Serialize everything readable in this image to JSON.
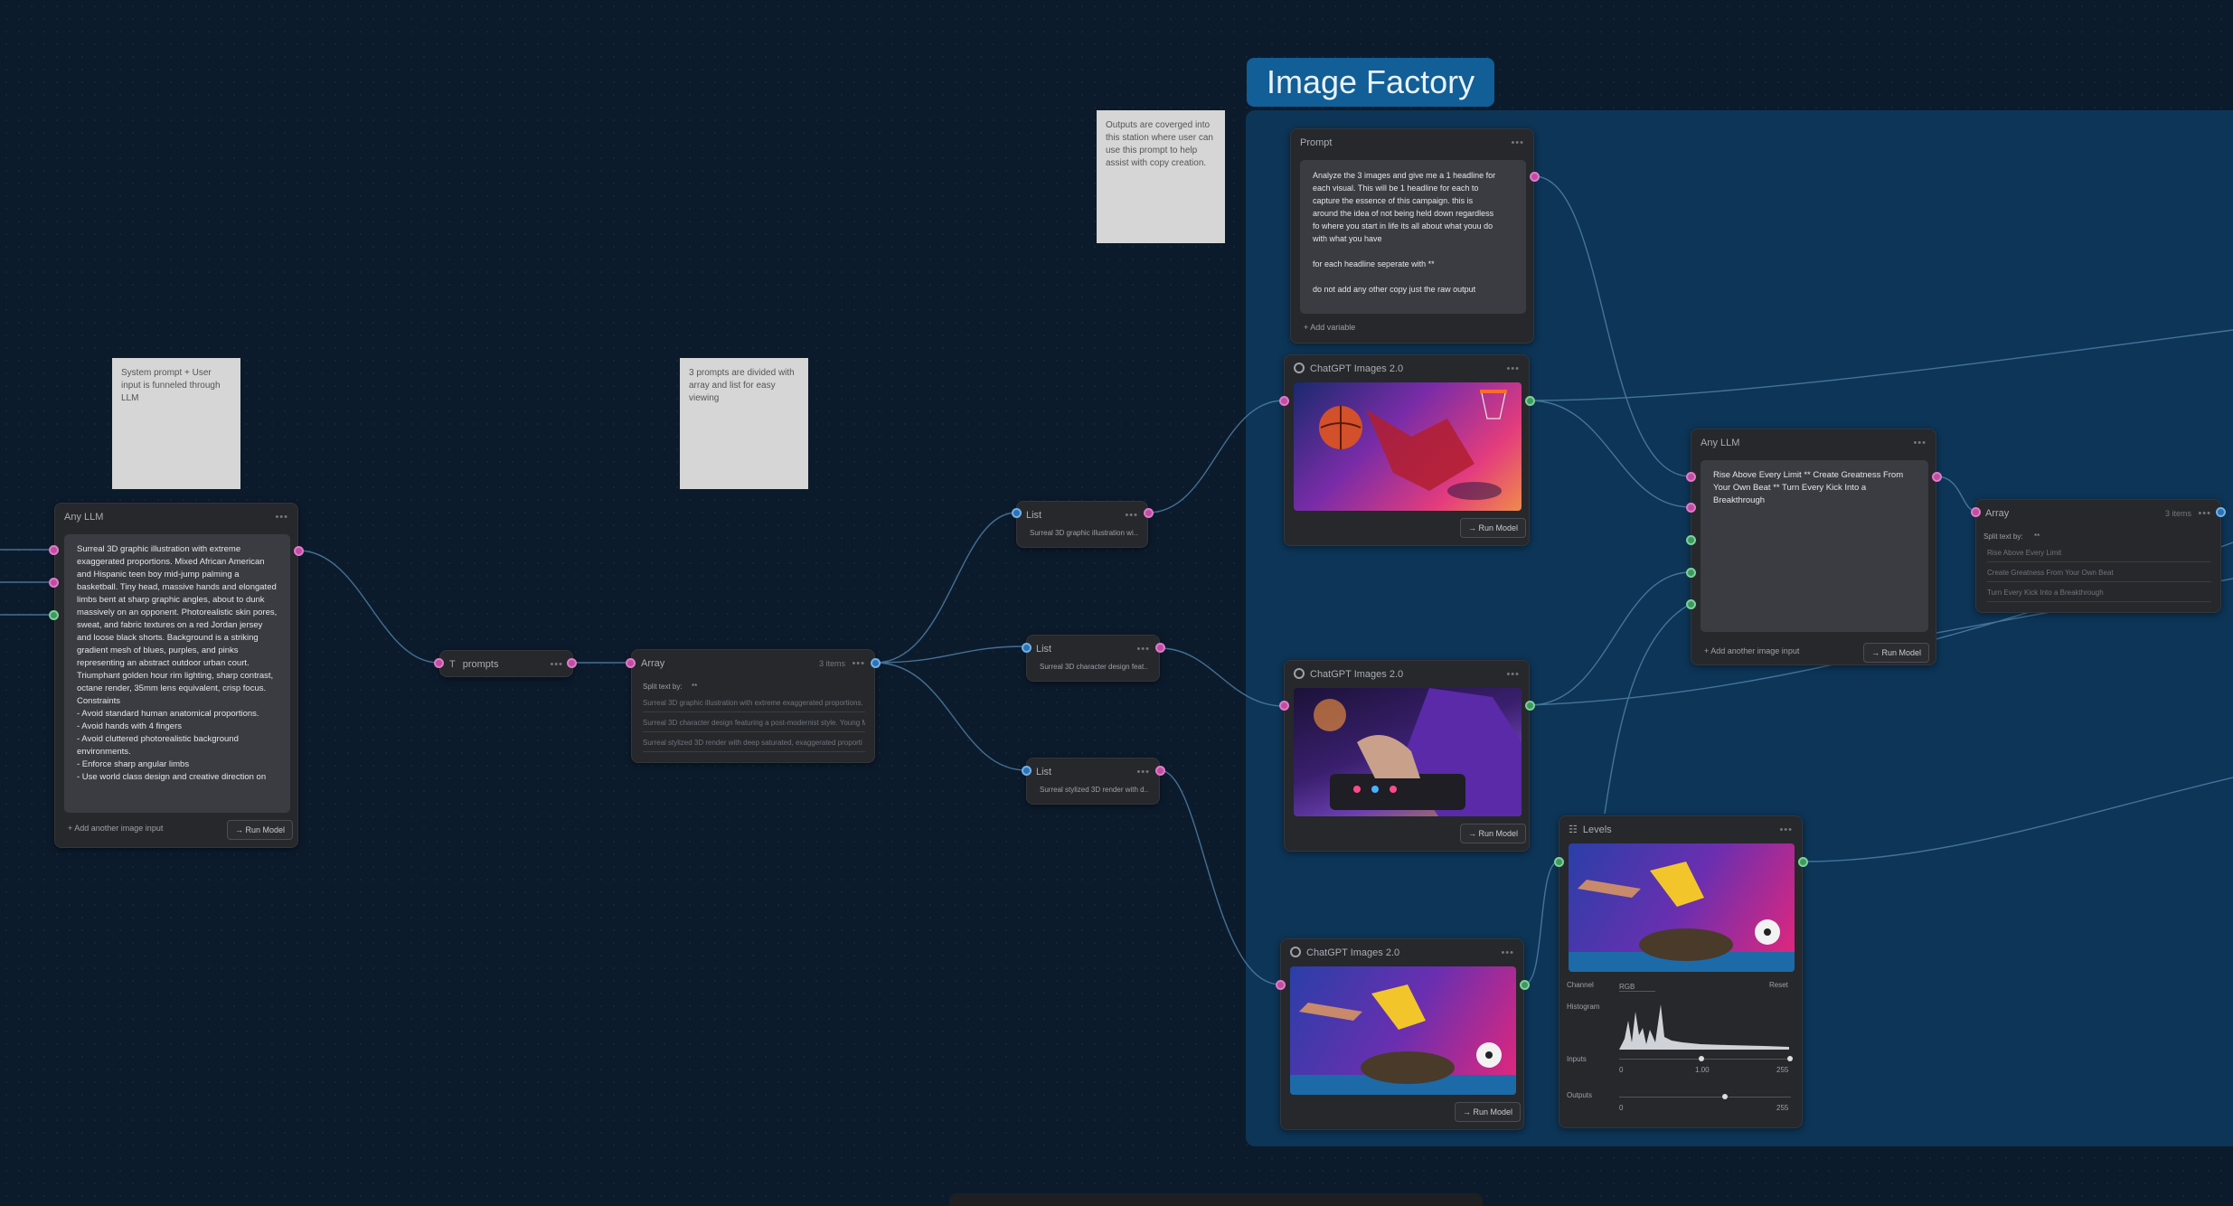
{
  "group": {
    "title": "Image Factory"
  },
  "notes": {
    "llm_note": "System prompt + User input is funneled through LLM",
    "array_note": "3 prompts are divided with array and list for easy viewing",
    "output_note": "Outputs are coverged into this station where user can use this prompt to help assist with copy creation."
  },
  "left_llm": {
    "title": "Any LLM",
    "text": "Surreal 3D graphic illustration with extreme exaggerated proportions. Mixed African American and Hispanic teen boy mid-jump palming a basketball. Tiny head, massive hands and elongated limbs bent at sharp graphic angles, about to dunk massively on an opponent. Photorealistic skin pores, sweat, and fabric textures on a red Jordan jersey and loose black shorts. Background is a striking gradient mesh of blues, purples, and pinks representing an abstract outdoor urban court. Triumphant golden hour rim lighting, sharp contrast, octane render, 35mm lens equivalent, crisp focus.\nConstraints\n- Avoid standard human anatomical proportions.\n- Avoid hands with 4 fingers\n- Avoid cluttered photorealistic background environments.\n- Enforce sharp angular limbs\n- Use world class design and creative direction on",
    "add_input": "+ Add another image input",
    "run": "→ Run Model"
  },
  "prompts_node": {
    "icon": "T",
    "label": "prompts"
  },
  "array_node": {
    "title": "Array",
    "count": "3 items",
    "split_label": "Split text by:",
    "split_value": "**",
    "items": [
      "Surreal 3D graphic illustration with extreme exaggerated proportions. M",
      "Surreal 3D character design featuring a post-modernist style. Young M",
      "Surreal stylized 3D render with deep saturated, exaggerated proporti"
    ]
  },
  "lists": [
    {
      "title": "List",
      "text": "Surreal 3D graphic illustration wi..."
    },
    {
      "title": "List",
      "text": "Surreal 3D character design feat..."
    },
    {
      "title": "List",
      "text": "Surreal stylized 3D render with d..."
    }
  ],
  "prompt_node": {
    "title": "Prompt",
    "lines": [
      "Analyze the 3 images and give me a 1 headline for",
      "each visual. This will be 1 headline  for each to",
      "capture the essence of this campaign. this is",
      "around the idea of not being held down regardless",
      "fo where you start in life its all about what youu do",
      "with what you have",
      "",
      "for each headline seperate with **",
      "",
      "do not add any other copy just the raw output"
    ],
    "add_variable": "+ Add variable"
  },
  "gpt_nodes": [
    {
      "title": "ChatGPT Images 2.0",
      "run": "→ Run Model"
    },
    {
      "title": "ChatGPT Images 2.0",
      "run": "→ Run Model"
    },
    {
      "title": "ChatGPT Images 2.0",
      "run": "→ Run Model"
    }
  ],
  "right_llm": {
    "title": "Any LLM",
    "text": "Rise Above Every Limit ** Create Greatness From Your Own Beat ** Turn Every Kick Into a Breakthrough",
    "add_input": "+ Add another image input",
    "run": "→ Run Model"
  },
  "right_array": {
    "title": "Array",
    "count": "3 items",
    "split_label": "Split text by:",
    "split_value": "**",
    "items": [
      "Rise Above Every Limit",
      "Create Greatness From Your Own Beat",
      "Turn Every Kick Into a Breakthrough"
    ]
  },
  "levels_node": {
    "title": "Levels",
    "channel_label": "Channel",
    "channel_value": "RGB",
    "reset": "Reset",
    "histogram_label": "Histogram",
    "inputs_label": "Inputs",
    "inputs_values": [
      "0",
      "1.00",
      "255"
    ],
    "outputs_label": "Outputs",
    "outputs_values": [
      "0",
      "255"
    ]
  },
  "colors": {
    "canvas": "#0c1b2c",
    "group": "#0d3557",
    "group_title": "#125e96",
    "port_pink": "#e07ac8",
    "port_green": "#7fcf9a",
    "port_blue": "#6fb1ea"
  }
}
